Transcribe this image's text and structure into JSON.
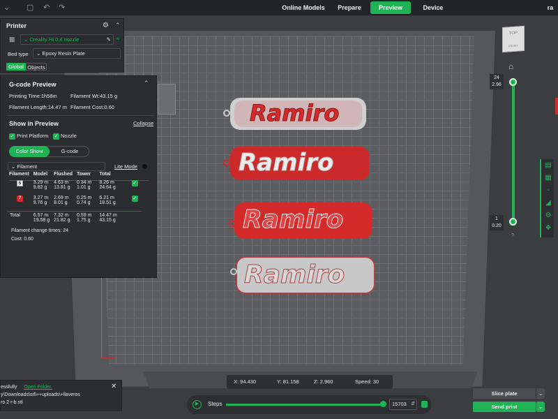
{
  "topbar": {
    "tabs": [
      "Online Models",
      "Prepare",
      "Preview",
      "Device"
    ],
    "active_tab": "Preview",
    "user": "ra"
  },
  "printer": {
    "title": "Printer",
    "printer_name": "Creality Hi 0.4 nozzle",
    "bed_type_label": "Bed type",
    "bed_type_value": "Epoxy Resin Plate",
    "scope_tabs": [
      "Global",
      "Objects"
    ]
  },
  "gcode": {
    "title": "G-code Preview",
    "printing_time": "Printing Time:1h58m",
    "filament_wt": "Filament Wt:43.15 g",
    "filament_length": "Filament Length:14.47 m",
    "filament_cost": "Filament Cost:0.60",
    "show_title": "Show in Preview",
    "collapse": "Collapse",
    "print_platform": "Print Platform",
    "nozzle": "Nozzle",
    "view_tabs": [
      "Color Show",
      "G-code"
    ],
    "filament_dropdown": "Filament",
    "lite_mode": "Lite Mode",
    "table": {
      "headers": [
        "Filament",
        "Model",
        "Flushed",
        "Tower",
        "Total"
      ],
      "rows": [
        {
          "id": "5",
          "color": "#ffffff",
          "model": [
            "3.29 m",
            "9.82 g"
          ],
          "flushed": [
            "4.63 m",
            "13.81 g"
          ],
          "tower": [
            "0.34 m",
            "1.01 g"
          ],
          "total": [
            "8.26 m",
            "24.64 g"
          ]
        },
        {
          "id": "7",
          "color": "#d42a2a",
          "model": [
            "3.27 m",
            "9.76 g"
          ],
          "flushed": [
            "2.69 m",
            "8.01 g"
          ],
          "tower": [
            "0.25 m",
            "0.74 g"
          ],
          "total": [
            "6.21 m",
            "18.51 g"
          ]
        }
      ],
      "total_row": {
        "label": "Total",
        "model": [
          "6.57 m",
          "19.58 g"
        ],
        "flushed": [
          "7.32 m",
          "21.82 g"
        ],
        "tower": [
          "0.59 m",
          "1.75 g"
        ],
        "total": [
          "14.47 m",
          "43.15 g"
        ]
      }
    },
    "change_times": "Filament change times:  24",
    "cost": "Cost:  0.60"
  },
  "notification": {
    "line1": "essfully",
    "open_folder": "Open Folder.",
    "line2": "y\\Downloads\\stl\\++uploads\\+llaveros",
    "line3": "ro 2 r-b.stl"
  },
  "models": [
    {
      "text": "Ramiro",
      "fill": "#d42a2a",
      "border": "#cfcfcf"
    },
    {
      "text": "Ramiro",
      "fill": "#e8e8e8",
      "border": "#cc2a2a"
    },
    {
      "text": "Ramiro",
      "fill": "#d42a2a",
      "border": "#d42a2a"
    },
    {
      "text": "Ramiro",
      "fill": "#c8c8c8",
      "border": "#b04040"
    }
  ],
  "layer_slider": {
    "top_layer": "24",
    "top_height": "2.96",
    "bottom_layer": "1",
    "bottom_height": "0.20",
    "help": "?"
  },
  "status": {
    "x": "X: 94.430",
    "y": "Y: 81.158",
    "z": "Z: 2.960",
    "speed": "Speed: 30"
  },
  "steps": {
    "label": "Steps",
    "value": "15703",
    "progress": 1.0
  },
  "actions": {
    "slice": "Slice plate",
    "send": "Send print"
  },
  "view_cube": {
    "top": "TOP",
    "front": "FRONT"
  },
  "colors": {
    "accent": "#1fb356",
    "red": "#d42a2a"
  }
}
